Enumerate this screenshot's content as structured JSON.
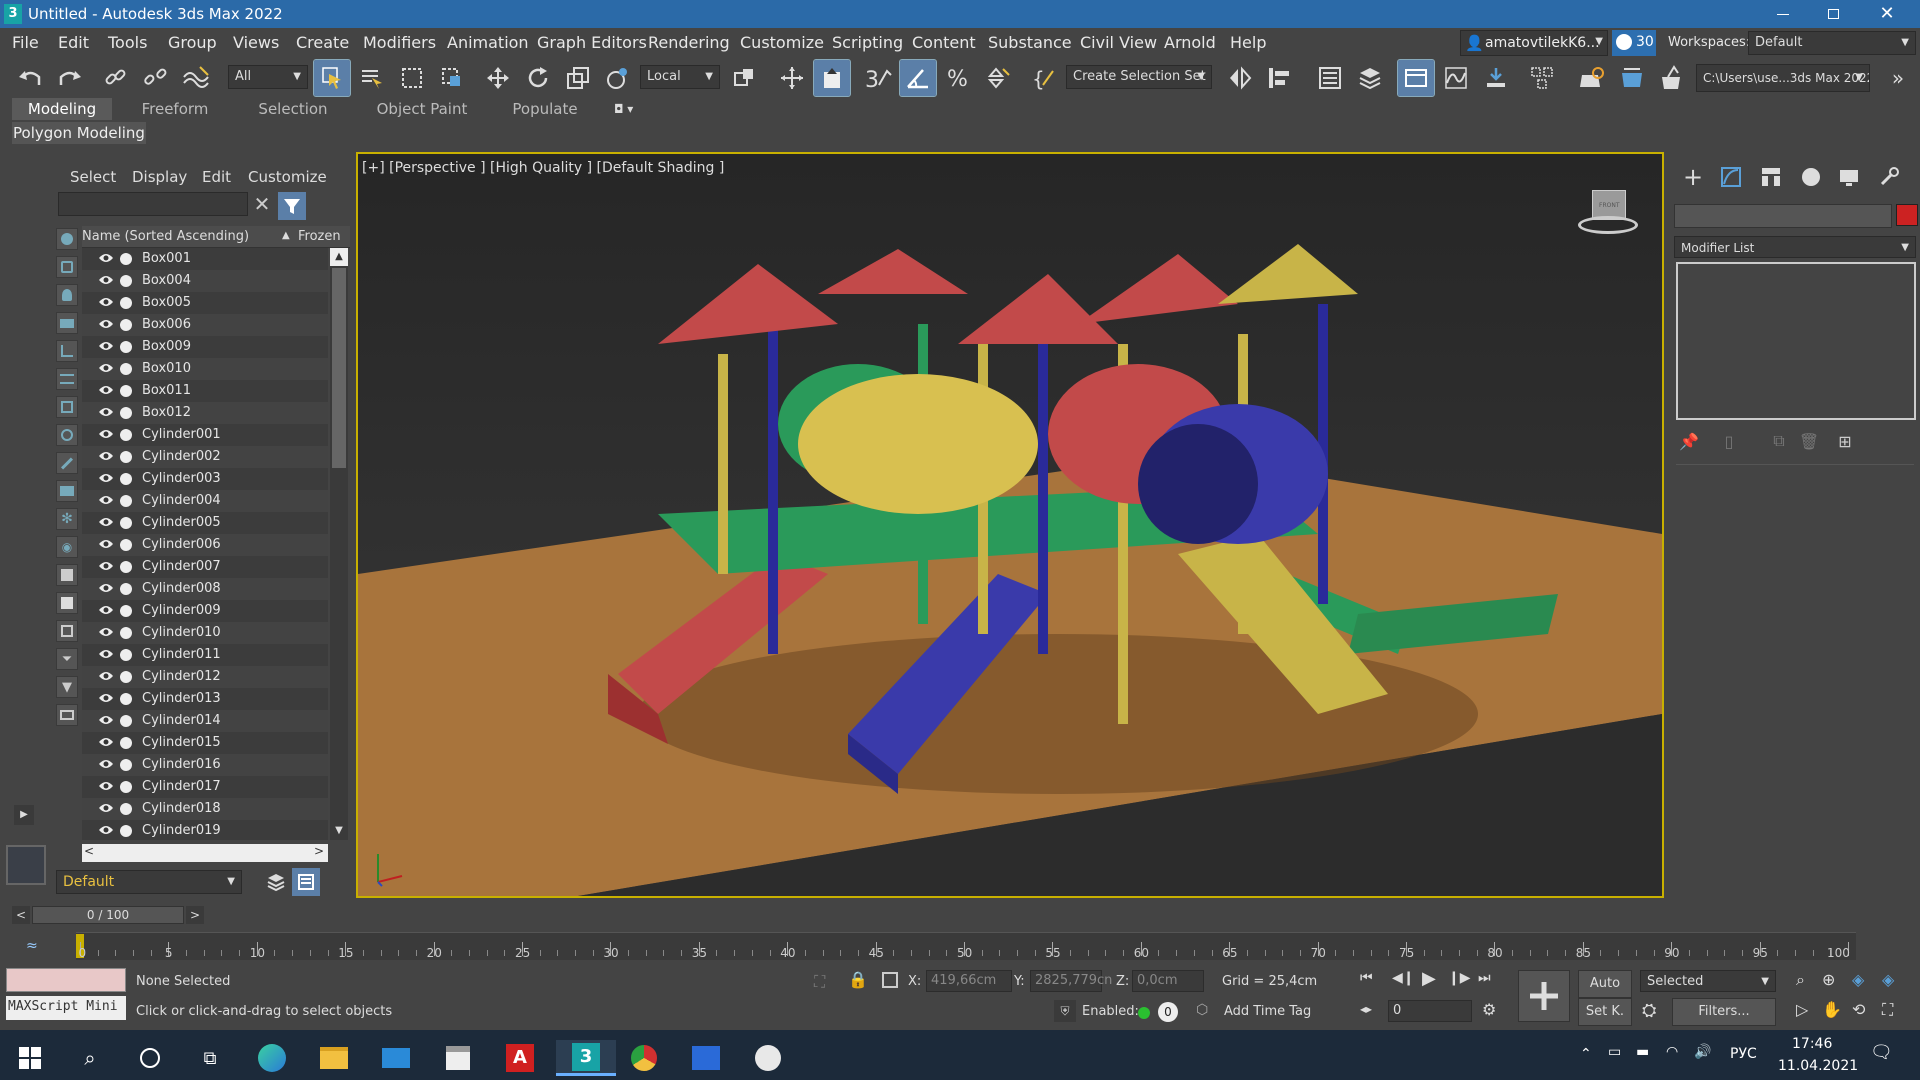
{
  "window": {
    "title": "Untitled - Autodesk 3ds Max 2022",
    "app_icon_label": "3"
  },
  "menu": {
    "items": [
      "File",
      "Edit",
      "Tools",
      "Group",
      "Views",
      "Create",
      "Modifiers",
      "Animation",
      "Graph Editors",
      "Rendering",
      "Customize",
      "Scripting",
      "Content",
      "Substance",
      "Civil View",
      "Arnold",
      "Help"
    ],
    "user": "amatovtilekK6...",
    "count": "30",
    "workspaces_label": "Workspaces:",
    "workspace_value": "Default"
  },
  "toolbar": {
    "filter_value": "All",
    "coord_value": "Local",
    "named_selection": "Create Selection Set",
    "project_path": "C:\\Users\\use...3ds Max 2022"
  },
  "ribbon": {
    "tabs": [
      "Modeling",
      "Freeform",
      "Selection",
      "Object Paint",
      "Populate"
    ],
    "active": "Modeling",
    "sub_label": "Polygon Modeling"
  },
  "scene_explorer": {
    "menu": [
      "Select",
      "Display",
      "Edit",
      "Customize"
    ],
    "search_placeholder": "",
    "col_name": "Name (Sorted Ascending)",
    "col_frozen": "Frozen",
    "items": [
      "Box001",
      "Box004",
      "Box005",
      "Box006",
      "Box009",
      "Box010",
      "Box011",
      "Box012",
      "Cylinder001",
      "Cylinder002",
      "Cylinder003",
      "Cylinder004",
      "Cylinder005",
      "Cylinder006",
      "Cylinder007",
      "Cylinder008",
      "Cylinder009",
      "Cylinder010",
      "Cylinder011",
      "Cylinder012",
      "Cylinder013",
      "Cylinder014",
      "Cylinder015",
      "Cylinder016",
      "Cylinder017",
      "Cylinder018",
      "Cylinder019"
    ],
    "layer_value": "Default"
  },
  "viewport": {
    "label": "[+] [Perspective ] [High Quality ] [Default Shading ]",
    "viewcube_label": "FRONT"
  },
  "command_panel": {
    "modifier_list": "Modifier List",
    "object_color": "#cc2222"
  },
  "timeline": {
    "frame_display": "0 / 100",
    "prev": "<",
    "next": ">",
    "ticks": [
      "0",
      "5",
      "10",
      "15",
      "20",
      "25",
      "30",
      "35",
      "40",
      "45",
      "50",
      "55",
      "60",
      "65",
      "70",
      "75",
      "80",
      "85",
      "90",
      "95",
      "100"
    ]
  },
  "status": {
    "maxscript": "MAXScript Mini",
    "selection": "None Selected",
    "prompt": "Click or click-and-drag to select objects",
    "x_label": "X:",
    "x_value": "419,66cm",
    "y_label": "Y:",
    "y_value": "2825,779cn",
    "z_label": "Z:",
    "z_value": "0,0cm",
    "grid": "Grid = 25,4cm",
    "enabled_label": "Enabled:",
    "enabled_value": "0",
    "time_tag": "Add Time Tag",
    "auto": "Auto",
    "setk": "Set K.",
    "key_mode": "Selected",
    "filters": "Filters...",
    "frame_value": "0"
  },
  "taskbar": {
    "lang": "РУС",
    "time": "17:46",
    "date": "11.04.2021"
  }
}
